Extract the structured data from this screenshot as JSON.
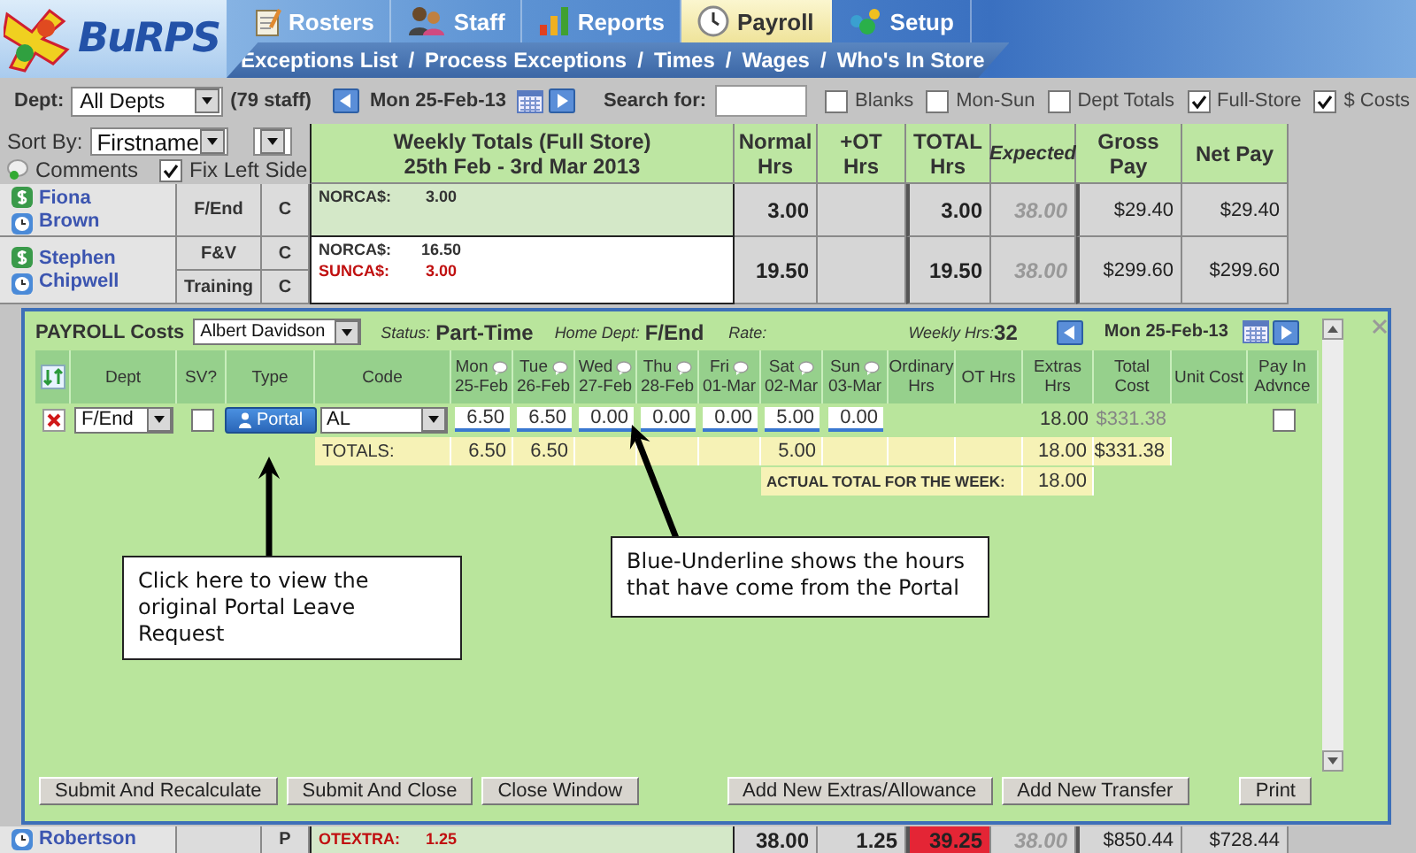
{
  "app": {
    "logo": "BuRPS"
  },
  "nav_tabs": [
    {
      "label": "Rosters",
      "selected": false
    },
    {
      "label": "Staff",
      "selected": false
    },
    {
      "label": "Reports",
      "selected": false
    },
    {
      "label": "Payroll",
      "selected": true
    },
    {
      "label": "Setup",
      "selected": false
    }
  ],
  "subnav": [
    {
      "label": "Exceptions List"
    },
    {
      "label": "Process Exceptions"
    },
    {
      "label": "Times"
    },
    {
      "label": "Wages"
    },
    {
      "label": "Who's In Store"
    }
  ],
  "subnav_separators": [
    "/",
    "/",
    "/",
    "/"
  ],
  "toolbar": {
    "dept_label": "Dept:",
    "dept": "All Depts",
    "staff_count": "(79 staff)",
    "date": "Mon 25-Feb-13",
    "search_label": "Search for:",
    "options": [
      {
        "label": "Blanks",
        "checked": false
      },
      {
        "label": "Mon-Sun",
        "checked": false
      },
      {
        "label": "Dept Totals",
        "checked": false
      },
      {
        "label": "Full-Store",
        "checked": true
      },
      {
        "label": "$ Costs",
        "checked": true
      }
    ]
  },
  "list_controls": {
    "sort_label": "Sort By:",
    "sort": "Firstname",
    "comments": "Comments",
    "fix_left": {
      "label": "Fix Left Side",
      "checked": true
    }
  },
  "table": {
    "weekly_title": "Weekly Totals (Full Store)",
    "weekly_range": "25th Feb - 3rd Mar 2013",
    "columns": [
      "Normal Hrs",
      "+OT Hrs",
      "TOTAL Hrs",
      "Expected",
      "Gross Pay",
      "Net Pay"
    ],
    "rows": [
      {
        "first_name": "Fiona",
        "last_name": "Brown",
        "highlight": true,
        "depts": [
          {
            "dept": "F/End",
            "type": "C"
          }
        ],
        "extras": [
          {
            "code": "NORCA$:",
            "value": "3.00",
            "kind": "normal"
          }
        ],
        "normal": "3.00",
        "total": "3.00",
        "total_alert": false,
        "expected": "38.00",
        "gross": "$29.40",
        "net": "$29.40"
      },
      {
        "first_name": "Stephen",
        "last_name": "Chipwell",
        "highlight": false,
        "depts": [
          {
            "dept": "F&V",
            "type": "C"
          },
          {
            "dept": "Training",
            "type": "C"
          }
        ],
        "extras": [
          {
            "code": "NORCA$:",
            "value": "16.50",
            "kind": "normal"
          },
          {
            "code": "SUNCA$:",
            "value": "3.00",
            "kind": "alert"
          }
        ],
        "normal": "19.50",
        "total": "19.50",
        "total_alert": false,
        "expected": "38.00",
        "gross": "$299.60",
        "net": "$299.60"
      },
      {
        "last_name": "Robertson",
        "highlight": true,
        "depts": [
          {
            "type": "P"
          }
        ],
        "extras": [
          {
            "code": "OTEXTRA:",
            "value": "1.25",
            "kind": "alert"
          }
        ],
        "normal": "38.00",
        "ot": "1.25",
        "total": "39.25",
        "total_alert": true,
        "expected": "38.00",
        "gross": "$850.44",
        "net": "$728.44"
      }
    ]
  },
  "payroll": {
    "title": "PAYROLL Costs",
    "employee": "Albert Davidson",
    "status_label": "Status:",
    "status": "Part-Time",
    "home_label": "Home Dept:",
    "home": "F/End",
    "rate_label": "Rate:",
    "weekly_label": "Weekly Hrs:",
    "weekly": "32",
    "date": "Mon 25-Feb-13",
    "columns": [
      "Dept",
      "SV?",
      "Type",
      "Code"
    ],
    "days": [
      {
        "day": "Mon",
        "date": "25-Feb"
      },
      {
        "day": "Tue",
        "date": "26-Feb"
      },
      {
        "day": "Wed",
        "date": "27-Feb"
      },
      {
        "day": "Thu",
        "date": "28-Feb"
      },
      {
        "day": "Fri",
        "date": "01-Mar"
      },
      {
        "day": "Sat",
        "date": "02-Mar"
      },
      {
        "day": "Sun",
        "date": "03-Mar"
      }
    ],
    "columns_after": [
      "Ordinary Hrs",
      "OT Hrs",
      "Extras Hrs",
      "Total Cost",
      "Unit Cost",
      "Pay In Advnce"
    ],
    "lines": [
      {
        "dept": "F/End",
        "sv": false,
        "type": "Portal",
        "code": "AL",
        "days": [
          {
            "value": "6.50",
            "from_portal": true
          },
          {
            "value": "6.50",
            "from_portal": true
          },
          {
            "value": "0.00",
            "from_portal": true
          },
          {
            "value": "0.00",
            "from_portal": true
          },
          {
            "value": "0.00",
            "from_portal": true
          },
          {
            "value": "5.00",
            "from_portal": true
          },
          {
            "value": "0.00",
            "from_portal": true
          }
        ],
        "extras": "18.00",
        "total": "$331.38",
        "pay_in_advance": false
      }
    ],
    "totals": {
      "label": "TOTALS:",
      "days": {
        "mon": "6.50",
        "tue": "6.50",
        "sat": "5.00"
      },
      "extras": "18.00",
      "total": "$331.38"
    },
    "actual": {
      "label": "ACTUAL TOTAL FOR THE WEEK:",
      "value": "18.00"
    },
    "buttons": [
      {
        "label": "Submit And Recalculate"
      },
      {
        "label": "Submit And Close"
      },
      {
        "label": "Close Window"
      },
      {
        "label": "Add New Extras/Allowance"
      },
      {
        "label": "Add New Transfer"
      },
      {
        "label": "Print"
      }
    ]
  },
  "callouts": [
    {
      "text": "Click here to view the original Portal Leave Request"
    },
    {
      "text": "Blue-Underline shows the hours that have come from the Portal"
    }
  ]
}
